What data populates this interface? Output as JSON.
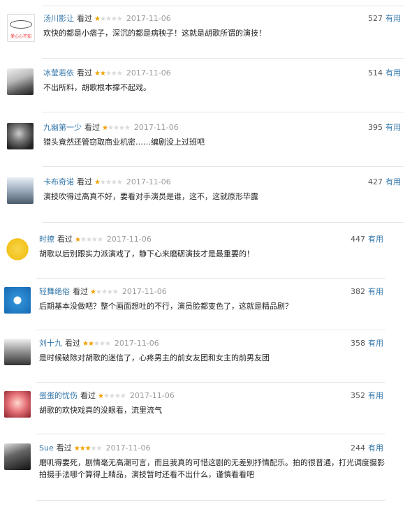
{
  "rating_star_color": "#f0a000",
  "link_color": "#3377aa",
  "comments": [
    {
      "user": "汤川影让",
      "seen": "看过",
      "stars": 1,
      "date": "2017-11-06",
      "text": "欢快的都是小痞子，深沉的都是病秧子！这就是胡歌所谓的演技！",
      "votes": "527",
      "useful": "有用",
      "avatar_text": "愛心心不知"
    },
    {
      "user": "冰莹若依",
      "seen": "看过",
      "stars": 2,
      "date": "2017-11-06",
      "text": "不出所料，胡歌根本撑不起戏。",
      "votes": "514",
      "useful": "有用"
    },
    {
      "user": "九幽第一少",
      "seen": "看过",
      "stars": 1,
      "date": "2017-11-06",
      "text": "猎头竟然还管窃取商业机密……编剧没上过班吧",
      "votes": "395",
      "useful": "有用"
    },
    {
      "user": "卡布奇诺",
      "seen": "看过",
      "stars": 1,
      "date": "2017-11-06",
      "text": "演技吹得过高真不好，要看对手演员是谁，这不，这就原形毕露",
      "votes": "427",
      "useful": "有用"
    },
    {
      "user": "时撩",
      "seen": "看过",
      "stars": 1,
      "date": "2017-11-06",
      "text": "胡歌以后别跟实力派演戏了，静下心来磨砺演技才是最重要的！",
      "votes": "447",
      "useful": "有用"
    },
    {
      "user": "轻舞绝俗",
      "seen": "看过",
      "stars": 1,
      "date": "2017-11-06",
      "text": "后期基本没做吧？整个画面想吐的不行，演员脸都变色了，这就是精品剧？",
      "votes": "382",
      "useful": "有用"
    },
    {
      "user": "刘十九",
      "seen": "看过",
      "stars": 2,
      "date": "2017-11-06",
      "text": "是时候破除对胡歌的迷信了，心疼男主的前女友团和女主的前男友团",
      "votes": "358",
      "useful": "有用"
    },
    {
      "user": "蛋蛋的忧伤",
      "seen": "看过",
      "stars": 1,
      "date": "2017-11-06",
      "text": "胡歌的欢快戏真的没眼看，流里流气",
      "votes": "352",
      "useful": "有用"
    },
    {
      "user": "Sue",
      "seen": "看过",
      "stars": 3,
      "date": "2017-11-06",
      "text": "磨叽得要死，剧情毫无高潮可言，而且我真的可惜这剧的无差别抒情配乐。拍的很普通，打光调度摄影拍摄手法哪个算得上精品，演技暂时还看不出什么，谨慎看看吧",
      "votes": "244",
      "useful": "有用"
    }
  ]
}
